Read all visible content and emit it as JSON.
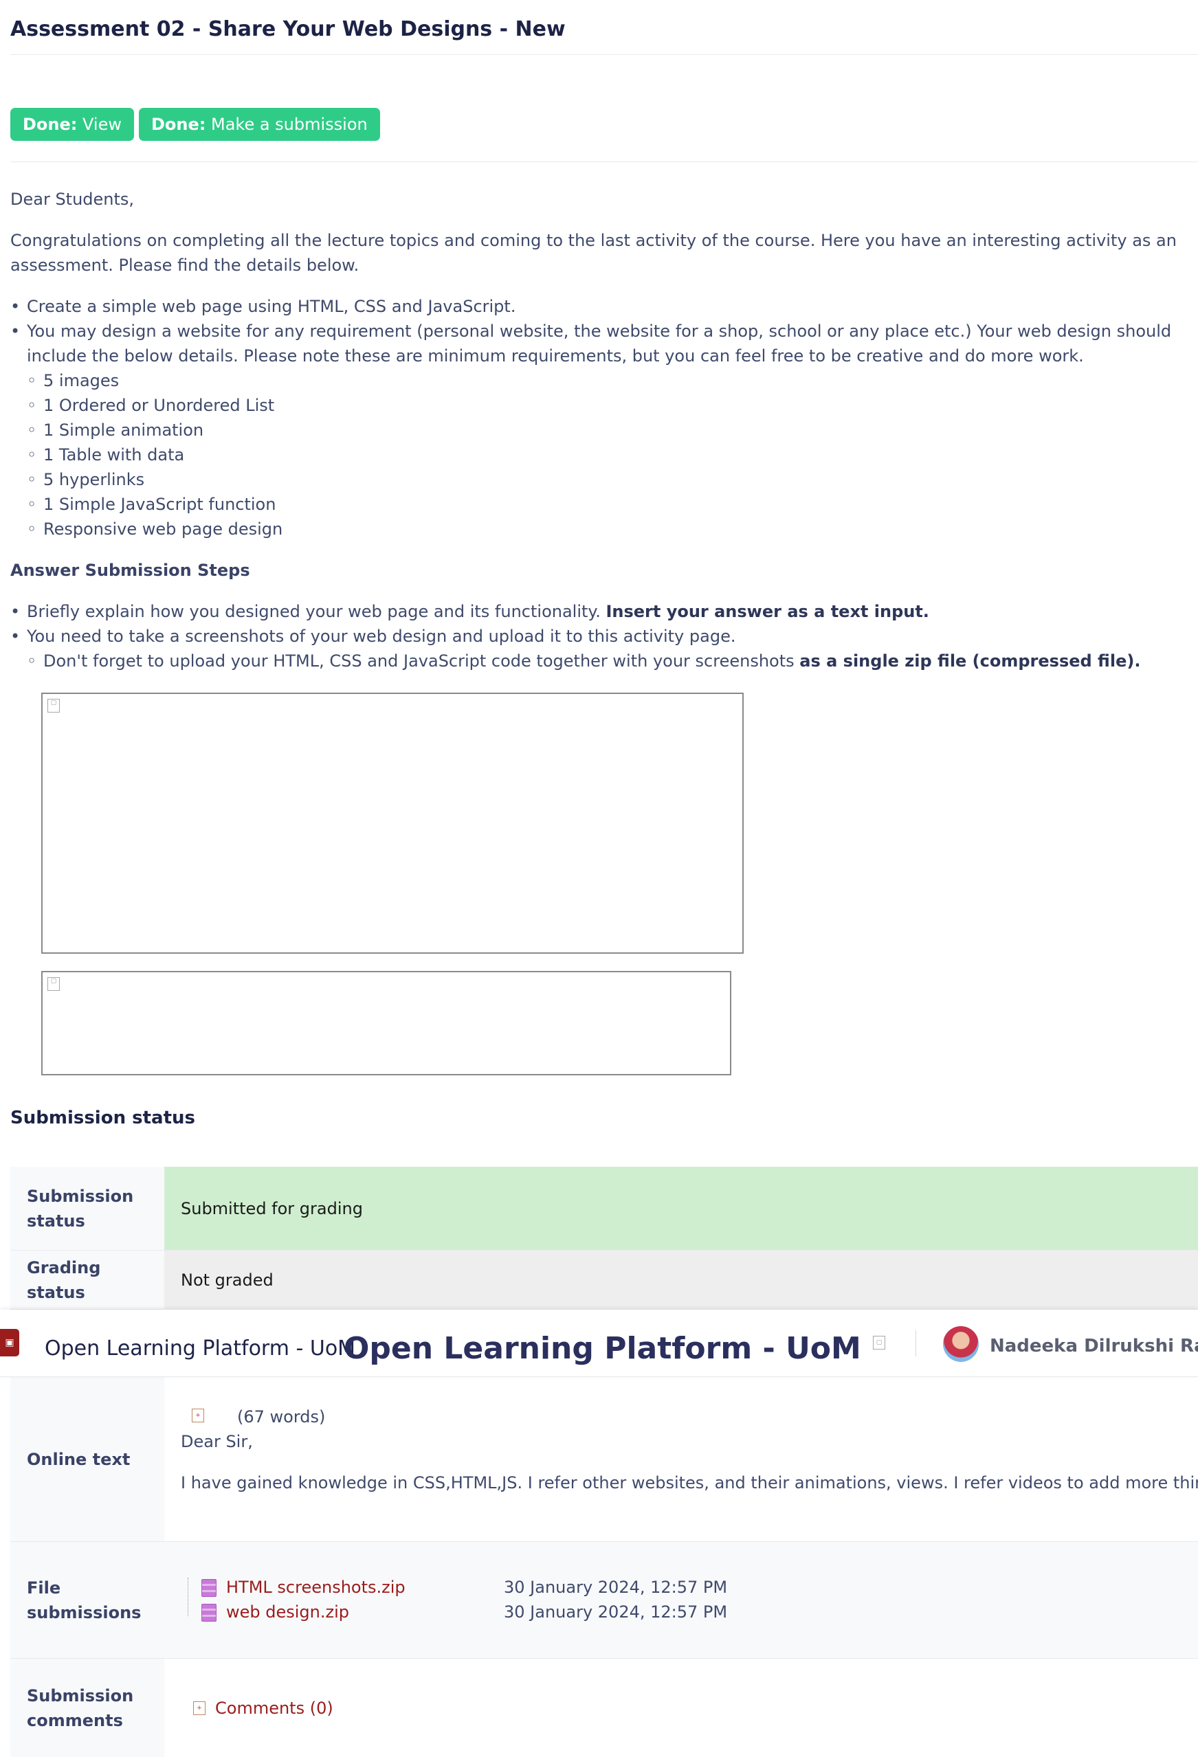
{
  "page": {
    "title": "Assessment 02 - Share Your Web Designs - New"
  },
  "completion": {
    "view": {
      "prefix": "Done:",
      "label": "View"
    },
    "submission": {
      "prefix": "Done:",
      "label": "Make a submission"
    },
    "color": "#2fcc87"
  },
  "intro": {
    "greeting": "Dear Students,",
    "paragraph": "Congratulations on completing all the lecture topics and coming to the last activity of the course. Here you have an interesting activity as an assessment. Please find the details below.",
    "bullets": [
      "Create a simple web page using HTML, CSS and JavaScript.",
      "You may design a website for any requirement (personal website, the website for a shop, school or any place etc.) Your web design should include the below details. Please note these are minimum requirements, but you can feel free to be creative and do more work."
    ],
    "requirements": [
      "5 images",
      "1 Ordered or Unordered List",
      "1 Simple animation",
      "1 Table with data",
      "5 hyperlinks",
      "1 Simple JavaScript function",
      "Responsive web page design"
    ]
  },
  "steps": {
    "heading": "Answer Submission Steps",
    "step1": {
      "text": "Briefly explain how you designed your web page and its functionality. ",
      "strong": "Insert your answer as a text input."
    },
    "step2": "You need to take a screenshots of your web design and upload it to this activity page.",
    "step2_sub": {
      "text": "Don't forget to upload your HTML, CSS and JavaScript code together with your screenshots ",
      "strong": "as a single zip file (compressed file)."
    }
  },
  "submission": {
    "heading": "Submission status",
    "status_label": "Submission status",
    "status_value": "Submitted for grading",
    "grading_label": "Grading status",
    "grading_value": "Not graded",
    "online_label": "Online text",
    "word_count": "(67 words)",
    "online_greeting": "Dear Sir,",
    "online_excerpt": "I have gained knowledge in CSS,HTML,JS. I refer other websites, and their animations, views. I refer videos to add more things …",
    "files_label": "File submissions",
    "files": [
      {
        "name": "HTML screenshots.zip",
        "date": "30 January 2024, 12:57 PM"
      },
      {
        "name": "web design.zip",
        "date": "30 January 2024, 12:57 PM"
      }
    ],
    "comments_label": "Submission comments",
    "comments_link": "Comments (0)"
  },
  "navbar": {
    "site_name": "Open Learning Platform - UoM",
    "site_name_large": "Open Learning Platform - UoM",
    "user_name": "Nadeeka Dilrukshi Rajapal",
    "brand_color": "#9a1c1c"
  }
}
